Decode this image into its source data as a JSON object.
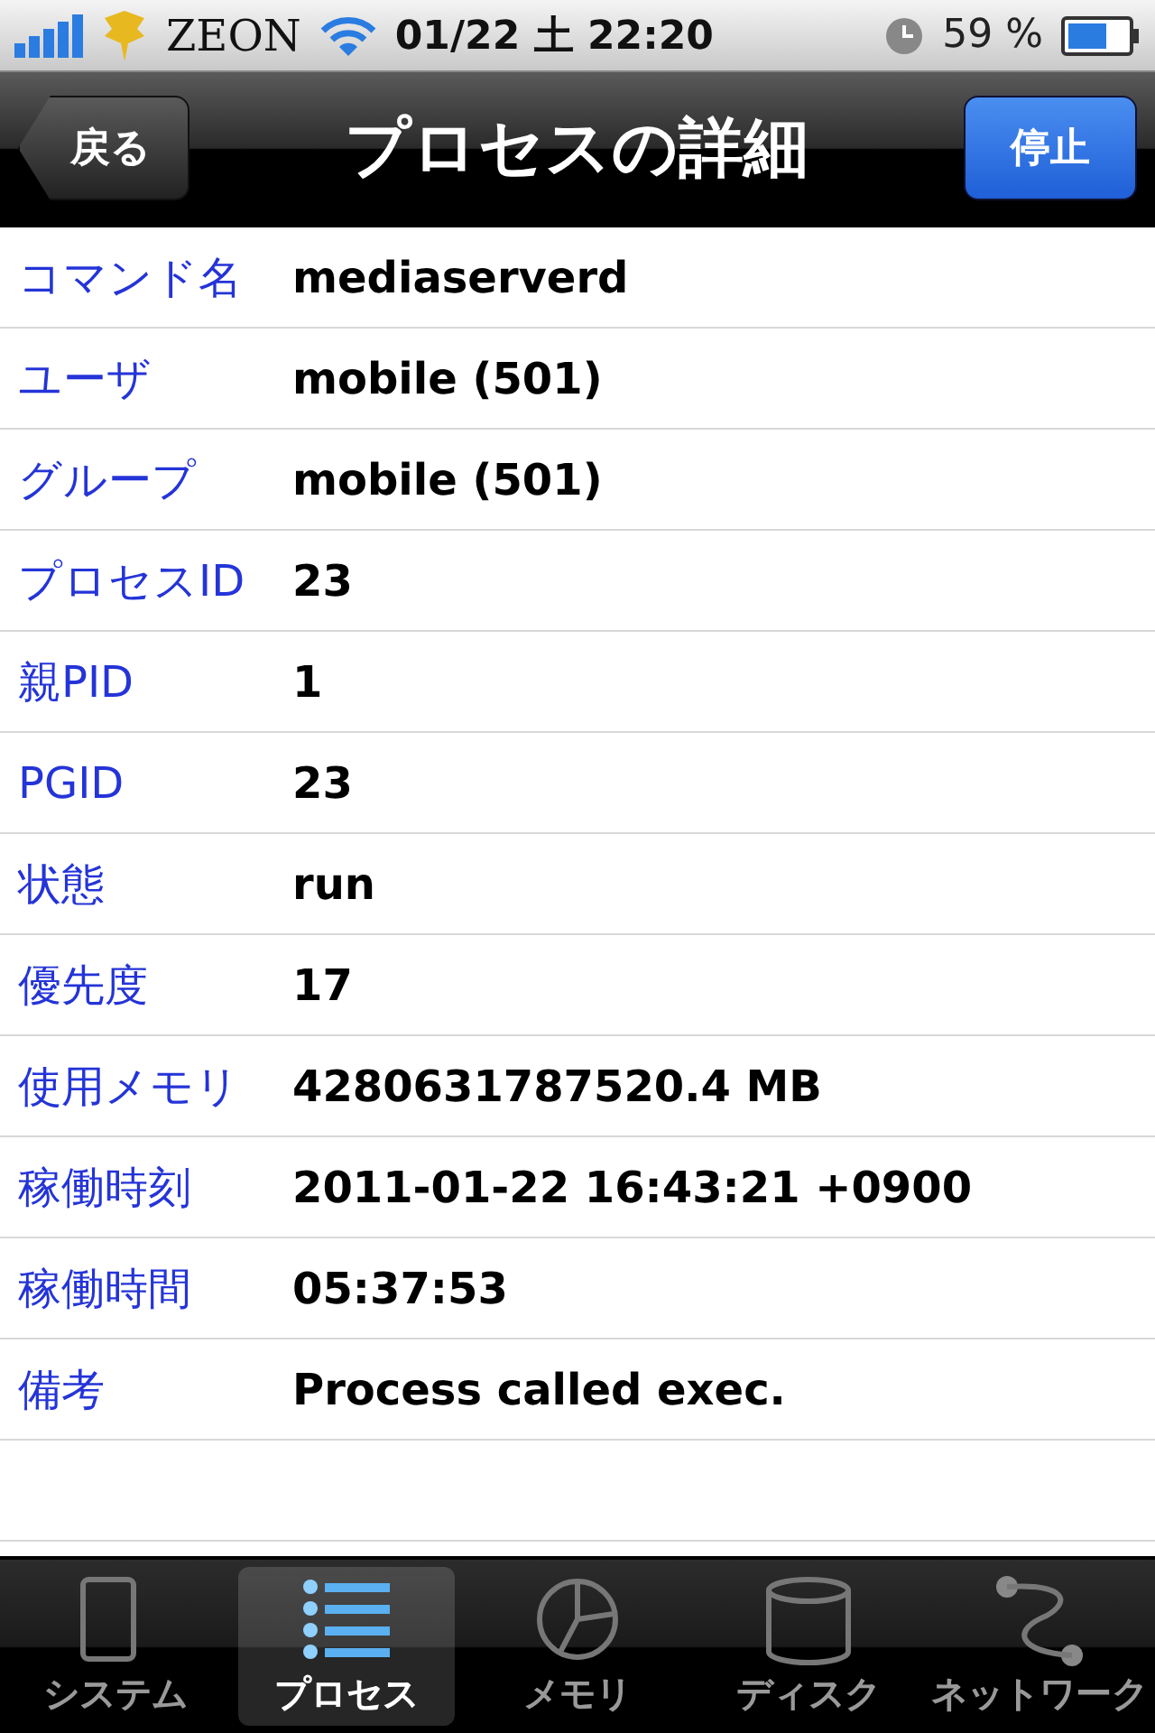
{
  "status_bar": {
    "carrier": "ZEON",
    "time": "01/22 土 22:20",
    "battery": "59 %"
  },
  "nav_bar": {
    "back": "戻る",
    "title": "プロセスの詳細",
    "action": "停止"
  },
  "details": [
    {
      "label": "コマンド名",
      "value": "mediaserverd"
    },
    {
      "label": "ユーザ",
      "value": "mobile (501)"
    },
    {
      "label": "グループ",
      "value": "mobile (501)"
    },
    {
      "label": "プロセスID",
      "value": "23"
    },
    {
      "label": "親PID",
      "value": "1"
    },
    {
      "label": "PGID",
      "value": "23"
    },
    {
      "label": "状態",
      "value": "run"
    },
    {
      "label": "優先度",
      "value": "17"
    },
    {
      "label": "使用メモリ",
      "value": "4280631787520.4 MB"
    },
    {
      "label": "稼働時刻",
      "value": "2011-01-22 16:43:21 +0900"
    },
    {
      "label": "稼働時間",
      "value": "05:37:53"
    },
    {
      "label": "備考",
      "value": "Process called exec."
    }
  ],
  "tab_bar": [
    {
      "label": "システム",
      "selected": false
    },
    {
      "label": "プロセス",
      "selected": true
    },
    {
      "label": "メモリ",
      "selected": false
    },
    {
      "label": "ディスク",
      "selected": false
    },
    {
      "label": "ネットワーク",
      "selected": false
    }
  ]
}
